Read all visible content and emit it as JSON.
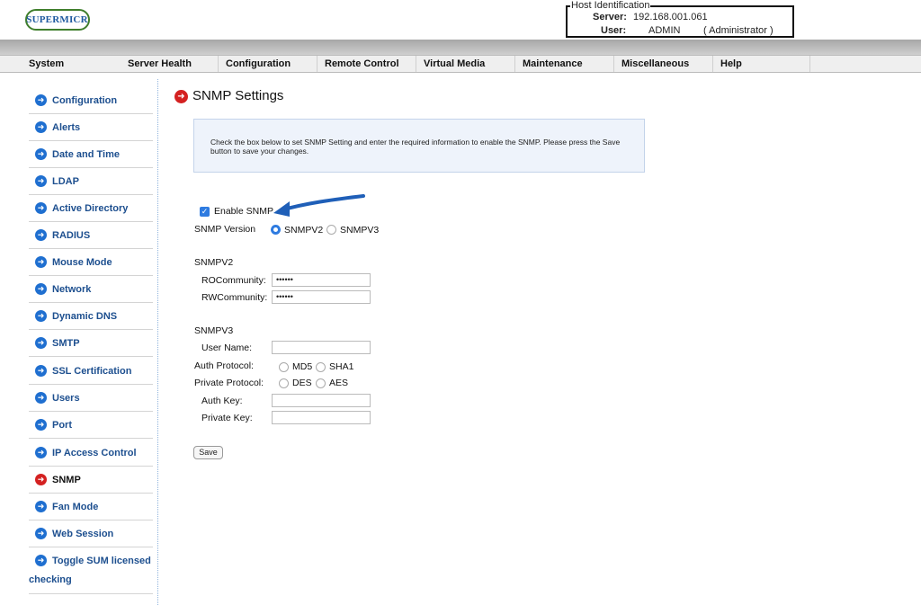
{
  "header": {
    "logo_text": "SUPERMICR",
    "host_identification": {
      "legend": "Host Identification",
      "server_label": "Server:",
      "server_value": "192.168.001.061",
      "user_label": "User:",
      "user_value": "ADMIN",
      "user_role": "( Administrator )"
    }
  },
  "menu": [
    "System",
    "Server Health",
    "Configuration",
    "Remote Control",
    "Virtual Media",
    "Maintenance",
    "Miscellaneous",
    "Help"
  ],
  "sidebar": {
    "items": [
      {
        "label": "Configuration"
      },
      {
        "label": "Alerts"
      },
      {
        "label": "Date and Time"
      },
      {
        "label": "LDAP"
      },
      {
        "label": "Active Directory"
      },
      {
        "label": "RADIUS"
      },
      {
        "label": "Mouse Mode"
      },
      {
        "label": "Network"
      },
      {
        "label": "Dynamic DNS"
      },
      {
        "label": "SMTP"
      },
      {
        "label": "SSL Certification"
      },
      {
        "label": "Users"
      },
      {
        "label": "Port"
      },
      {
        "label": "IP Access Control"
      },
      {
        "label": "SNMP",
        "active": true
      },
      {
        "label": "Fan Mode"
      },
      {
        "label": "Web Session"
      },
      {
        "label": "Toggle SUM licensed",
        "label2": "checking"
      }
    ]
  },
  "main": {
    "title": "SNMP Settings",
    "info": "Check the box below to set SNMP Setting and enter the required information to enable the SNMP. Please press the Save button to save your changes.",
    "enable_snmp": {
      "label": "Enable SNMP",
      "checked": true
    },
    "snmp_version": {
      "label": "SNMP Version",
      "options": [
        "SNMPV2",
        "SNMPV3"
      ],
      "selected": "SNMPV2"
    },
    "snmpv2": {
      "heading": "SNMPV2",
      "ro_label": "ROCommunity:",
      "ro_value": "••••••",
      "rw_label": "RWCommunity:",
      "rw_value": "••••••"
    },
    "snmpv3": {
      "heading": "SNMPV3",
      "user_name_label": "User Name:",
      "user_name_value": "",
      "auth_protocol_label": "Auth Protocol:",
      "auth_options": [
        "MD5",
        "SHA1"
      ],
      "private_protocol_label": "Private Protocol:",
      "private_options": [
        "DES",
        "AES"
      ],
      "auth_key_label": "Auth Key:",
      "auth_key_value": "",
      "private_key_label": "Private Key:",
      "private_key_value": ""
    },
    "save_label": "Save"
  },
  "colors": {
    "accent": "#2e7be0",
    "sidebar_link": "#1d4f8f",
    "active_icon": "#d42121",
    "arrow": "#1f5fb8"
  }
}
